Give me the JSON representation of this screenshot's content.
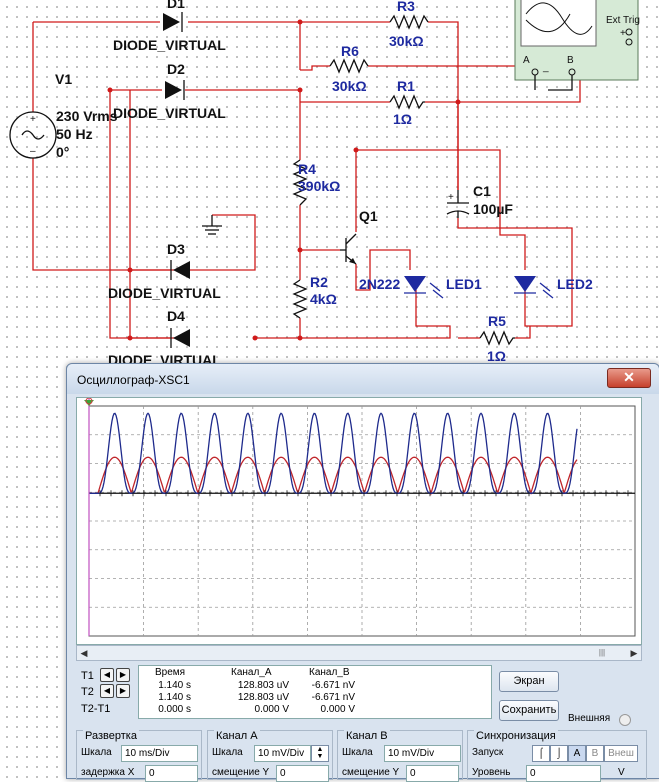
{
  "schematic": {
    "v1": {
      "name": "V1",
      "voltage": "230 Vrms",
      "freq": "50 Hz",
      "phase": "0°"
    },
    "diodes": [
      {
        "ref": "D1",
        "model": "DIODE_VIRTUAL"
      },
      {
        "ref": "D2",
        "model": "DIODE_VIRTUAL"
      },
      {
        "ref": "D3",
        "model": "DIODE_VIRTUAL"
      },
      {
        "ref": "D4",
        "model": "DIODE_VIRTUAL"
      }
    ],
    "resistors": {
      "r1": {
        "ref": "R1",
        "value": "1Ω"
      },
      "r2": {
        "ref": "R2",
        "value": "4kΩ"
      },
      "r3": {
        "ref": "R3",
        "value": "30kΩ"
      },
      "r4": {
        "ref": "R4",
        "value": "390kΩ"
      },
      "r5": {
        "ref": "R5",
        "value": "1Ω"
      },
      "r6": {
        "ref": "R6",
        "value": "30kΩ"
      }
    },
    "c1": {
      "ref": "C1",
      "value": "100µF"
    },
    "q1": {
      "ref": "Q1",
      "model": "2N222"
    },
    "led1": {
      "ref": "LED1"
    },
    "led2": {
      "ref": "LED2"
    },
    "scope_box": {
      "ext_trig": "Ext Trig",
      "a": "A",
      "b": "B",
      "plus": "+",
      "minus": "_"
    }
  },
  "oscilloscope": {
    "title": "Осциллограф-XSC1",
    "close": "✕",
    "colors": {
      "channel_a": "#1e2a8c",
      "channel_b": "#c0262b",
      "grid": "#9a9a9a"
    },
    "readout": {
      "t1": "T1",
      "t2": "T2",
      "t2t1": "T2-T1",
      "headers": {
        "time": "Время",
        "a": "Канал_А",
        "b": "Канал_В"
      },
      "rows": [
        {
          "time": "1.140 s",
          "a": "128.803 uV",
          "b": "-6.671 nV"
        },
        {
          "time": "1.140 s",
          "a": "128.803 uV",
          "b": "-6.671 nV"
        },
        {
          "time": "0.000 s",
          "a": "0.000 V",
          "b": "0.000 V"
        }
      ]
    },
    "buttons": {
      "screen": "Экран",
      "save": "Сохранить",
      "external": "Внешняя"
    },
    "timebase": {
      "title": "Развертка",
      "scale_label": "Шкала",
      "scale": "10 ms/Div",
      "offset_label": "задержка X",
      "offset": "0"
    },
    "channel_a": {
      "title": "Канал А",
      "scale_label": "Шкала",
      "scale": "10 mV/Div",
      "offset_label": "смещение Y",
      "offset": "0"
    },
    "channel_b": {
      "title": "Канал В",
      "scale_label": "Шкала",
      "scale": "10 mV/Div",
      "offset_label": "смещение Y",
      "offset": "0"
    },
    "trigger": {
      "title": "Синхронизация",
      "source_label": "Запуск",
      "level_label": "Уровень",
      "level": "0",
      "level_unit": "V",
      "a": "A",
      "b": "B",
      "ext": "Внеш"
    }
  }
}
